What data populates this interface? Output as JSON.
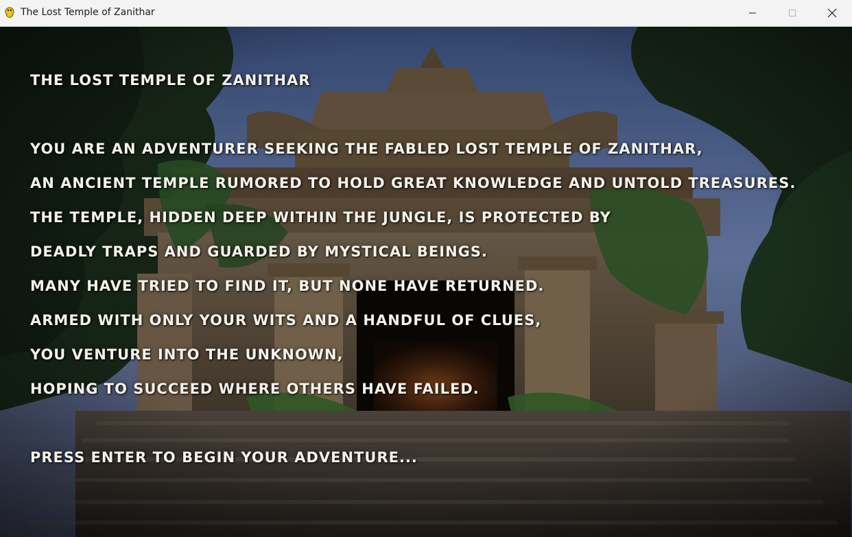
{
  "window": {
    "title": "The Lost Temple of Zanithar",
    "controls": [
      "minimize-icon",
      "maximize-icon",
      "close-icon"
    ]
  },
  "intro": {
    "title": "THE LOST TEMPLE OF ZANITHAR",
    "lines": [
      "YOU ARE AN ADVENTURER SEEKING THE FABLED LOST TEMPLE OF ZANITHAR,",
      "AN ANCIENT TEMPLE RUMORED TO HOLD GREAT KNOWLEDGE AND UNTOLD TREASURES.",
      "THE TEMPLE, HIDDEN DEEP WITHIN THE JUNGLE, IS PROTECTED BY",
      "DEADLY TRAPS AND GUARDED BY MYSTICAL BEINGS.",
      "MANY HAVE TRIED TO FIND IT, BUT NONE HAVE RETURNED.",
      "ARMED WITH ONLY YOUR WITS AND A HANDFUL OF CLUES,",
      "YOU VENTURE INTO THE UNKNOWN,",
      "HOPING TO SUCCEED WHERE OTHERS HAVE FAILED."
    ],
    "prompt": "PRESS ENTER TO BEGIN YOUR ADVENTURE..."
  },
  "colors": {
    "text": "#f4f1ea",
    "sky": "#6f86b8",
    "foliage": "#1e3a22",
    "stone": "#6b5a45"
  }
}
